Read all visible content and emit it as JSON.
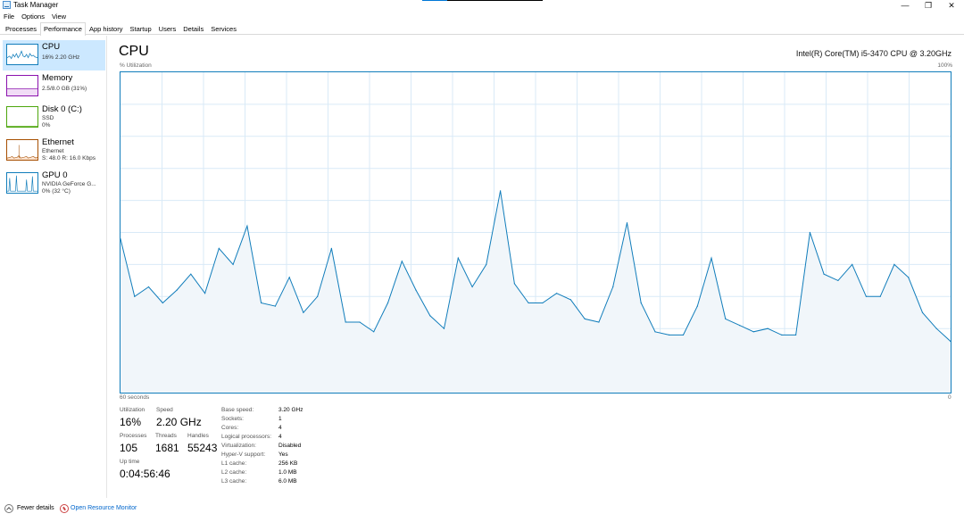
{
  "window": {
    "title": "Task Manager",
    "min_icon": "minimize-icon",
    "max_icon": "restore-icon",
    "close_icon": "close-icon"
  },
  "menu": [
    "File",
    "Options",
    "View"
  ],
  "tabs": [
    "Processes",
    "Performance",
    "App history",
    "Startup",
    "Users",
    "Details",
    "Services"
  ],
  "active_tab": "Performance",
  "sidebar": {
    "items": [
      {
        "title": "CPU",
        "line1": "16%  2.20 GHz",
        "line2": "",
        "color": "#117dbb"
      },
      {
        "title": "Memory",
        "line1": "2.5/8.0 GB (31%)",
        "line2": "",
        "color": "#8b12ae"
      },
      {
        "title": "Disk 0 (C:)",
        "line1": "SSD",
        "line2": "0%",
        "color": "#4da60c"
      },
      {
        "title": "Ethernet",
        "line1": "Ethernet",
        "line2": "S: 48.0  R: 16.0 Kbps",
        "color": "#a74f01"
      },
      {
        "title": "GPU 0",
        "line1": "NVIDIA GeForce G...",
        "line2": "0%  (32 °C)",
        "color": "#117dbb"
      }
    ]
  },
  "main": {
    "title": "CPU",
    "model": "Intel(R) Core(TM) i5-3470 CPU @ 3.20GHz",
    "util_label": "% Utilization",
    "max_label": "100%",
    "axis_left": "60 seconds",
    "axis_right": "0"
  },
  "chart_data": {
    "type": "area",
    "ylim": [
      0,
      100
    ],
    "x_range_seconds": [
      60,
      0
    ],
    "grid": true,
    "color": "#117dbb",
    "values": [
      48,
      30,
      33,
      28,
      32,
      37,
      31,
      45,
      40,
      52,
      28,
      27,
      36,
      25,
      30,
      45,
      22,
      22,
      19,
      28,
      41,
      32,
      24,
      20,
      42,
      33,
      40,
      63,
      34,
      28,
      28,
      31,
      29,
      23,
      22,
      33,
      53,
      28,
      19,
      18,
      18,
      27,
      42,
      23,
      21,
      19,
      20,
      18,
      18,
      50,
      37,
      35,
      40,
      30,
      30,
      40,
      36,
      25,
      20,
      16
    ]
  },
  "stats": {
    "utilization_label": "Utilization",
    "utilization": "16%",
    "speed_label": "Speed",
    "speed": "2.20 GHz",
    "processes_label": "Processes",
    "processes": "105",
    "threads_label": "Threads",
    "threads": "1681",
    "handles_label": "Handles",
    "handles": "55243",
    "uptime_label": "Up time",
    "uptime": "0:04:56:46"
  },
  "specs": [
    {
      "label": "Base speed:",
      "value": "3.20 GHz"
    },
    {
      "label": "Sockets:",
      "value": "1"
    },
    {
      "label": "Cores:",
      "value": "4"
    },
    {
      "label": "Logical processors:",
      "value": "4"
    },
    {
      "label": "Virtualization:",
      "value": "Disabled"
    },
    {
      "label": "Hyper-V support:",
      "value": "Yes"
    },
    {
      "label": "L1 cache:",
      "value": "256 KB"
    },
    {
      "label": "L2 cache:",
      "value": "1.0 MB"
    },
    {
      "label": "L3 cache:",
      "value": "6.0 MB"
    }
  ],
  "footer": {
    "fewer_details": "Fewer details",
    "open_resource_monitor": "Open Resource Monitor"
  }
}
